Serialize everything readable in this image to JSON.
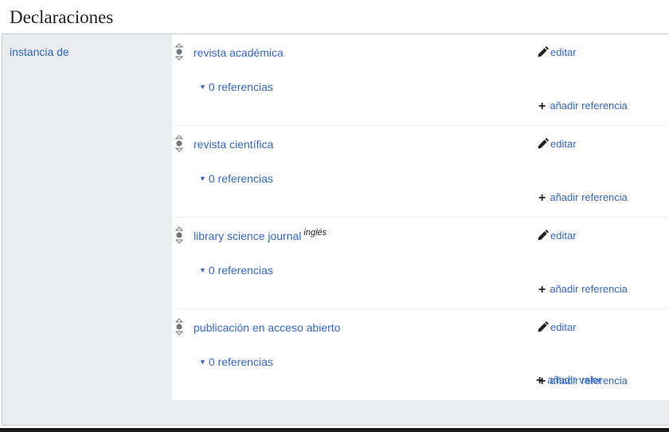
{
  "section": {
    "title": "Declaraciones"
  },
  "property": {
    "label": "instancia de"
  },
  "statements": [
    {
      "value": "revista académica",
      "qualifier": "",
      "edit": "editar",
      "references": "0 referencias",
      "add_reference": "añadir referencia"
    },
    {
      "value": "revista científica",
      "qualifier": "",
      "edit": "editar",
      "references": "0 referencias",
      "add_reference": "añadir referencia"
    },
    {
      "value": "library science journal",
      "qualifier": "inglés",
      "edit": "editar",
      "references": "0 referencias",
      "add_reference": "añadir referencia"
    },
    {
      "value": "publicación en acceso abierto",
      "qualifier": "",
      "edit": "editar",
      "references": "0 referencias",
      "add_reference": "añadir referencia"
    }
  ],
  "add_value": "añadir valor",
  "icons": {
    "rank": "rank-selector-icon",
    "edit": "pencil-icon",
    "add": "plus-icon",
    "expand": "triangle-down-icon"
  },
  "colors": {
    "link": "#3366cc",
    "panel": "#eaecf0",
    "border": "#c8ccd1"
  }
}
